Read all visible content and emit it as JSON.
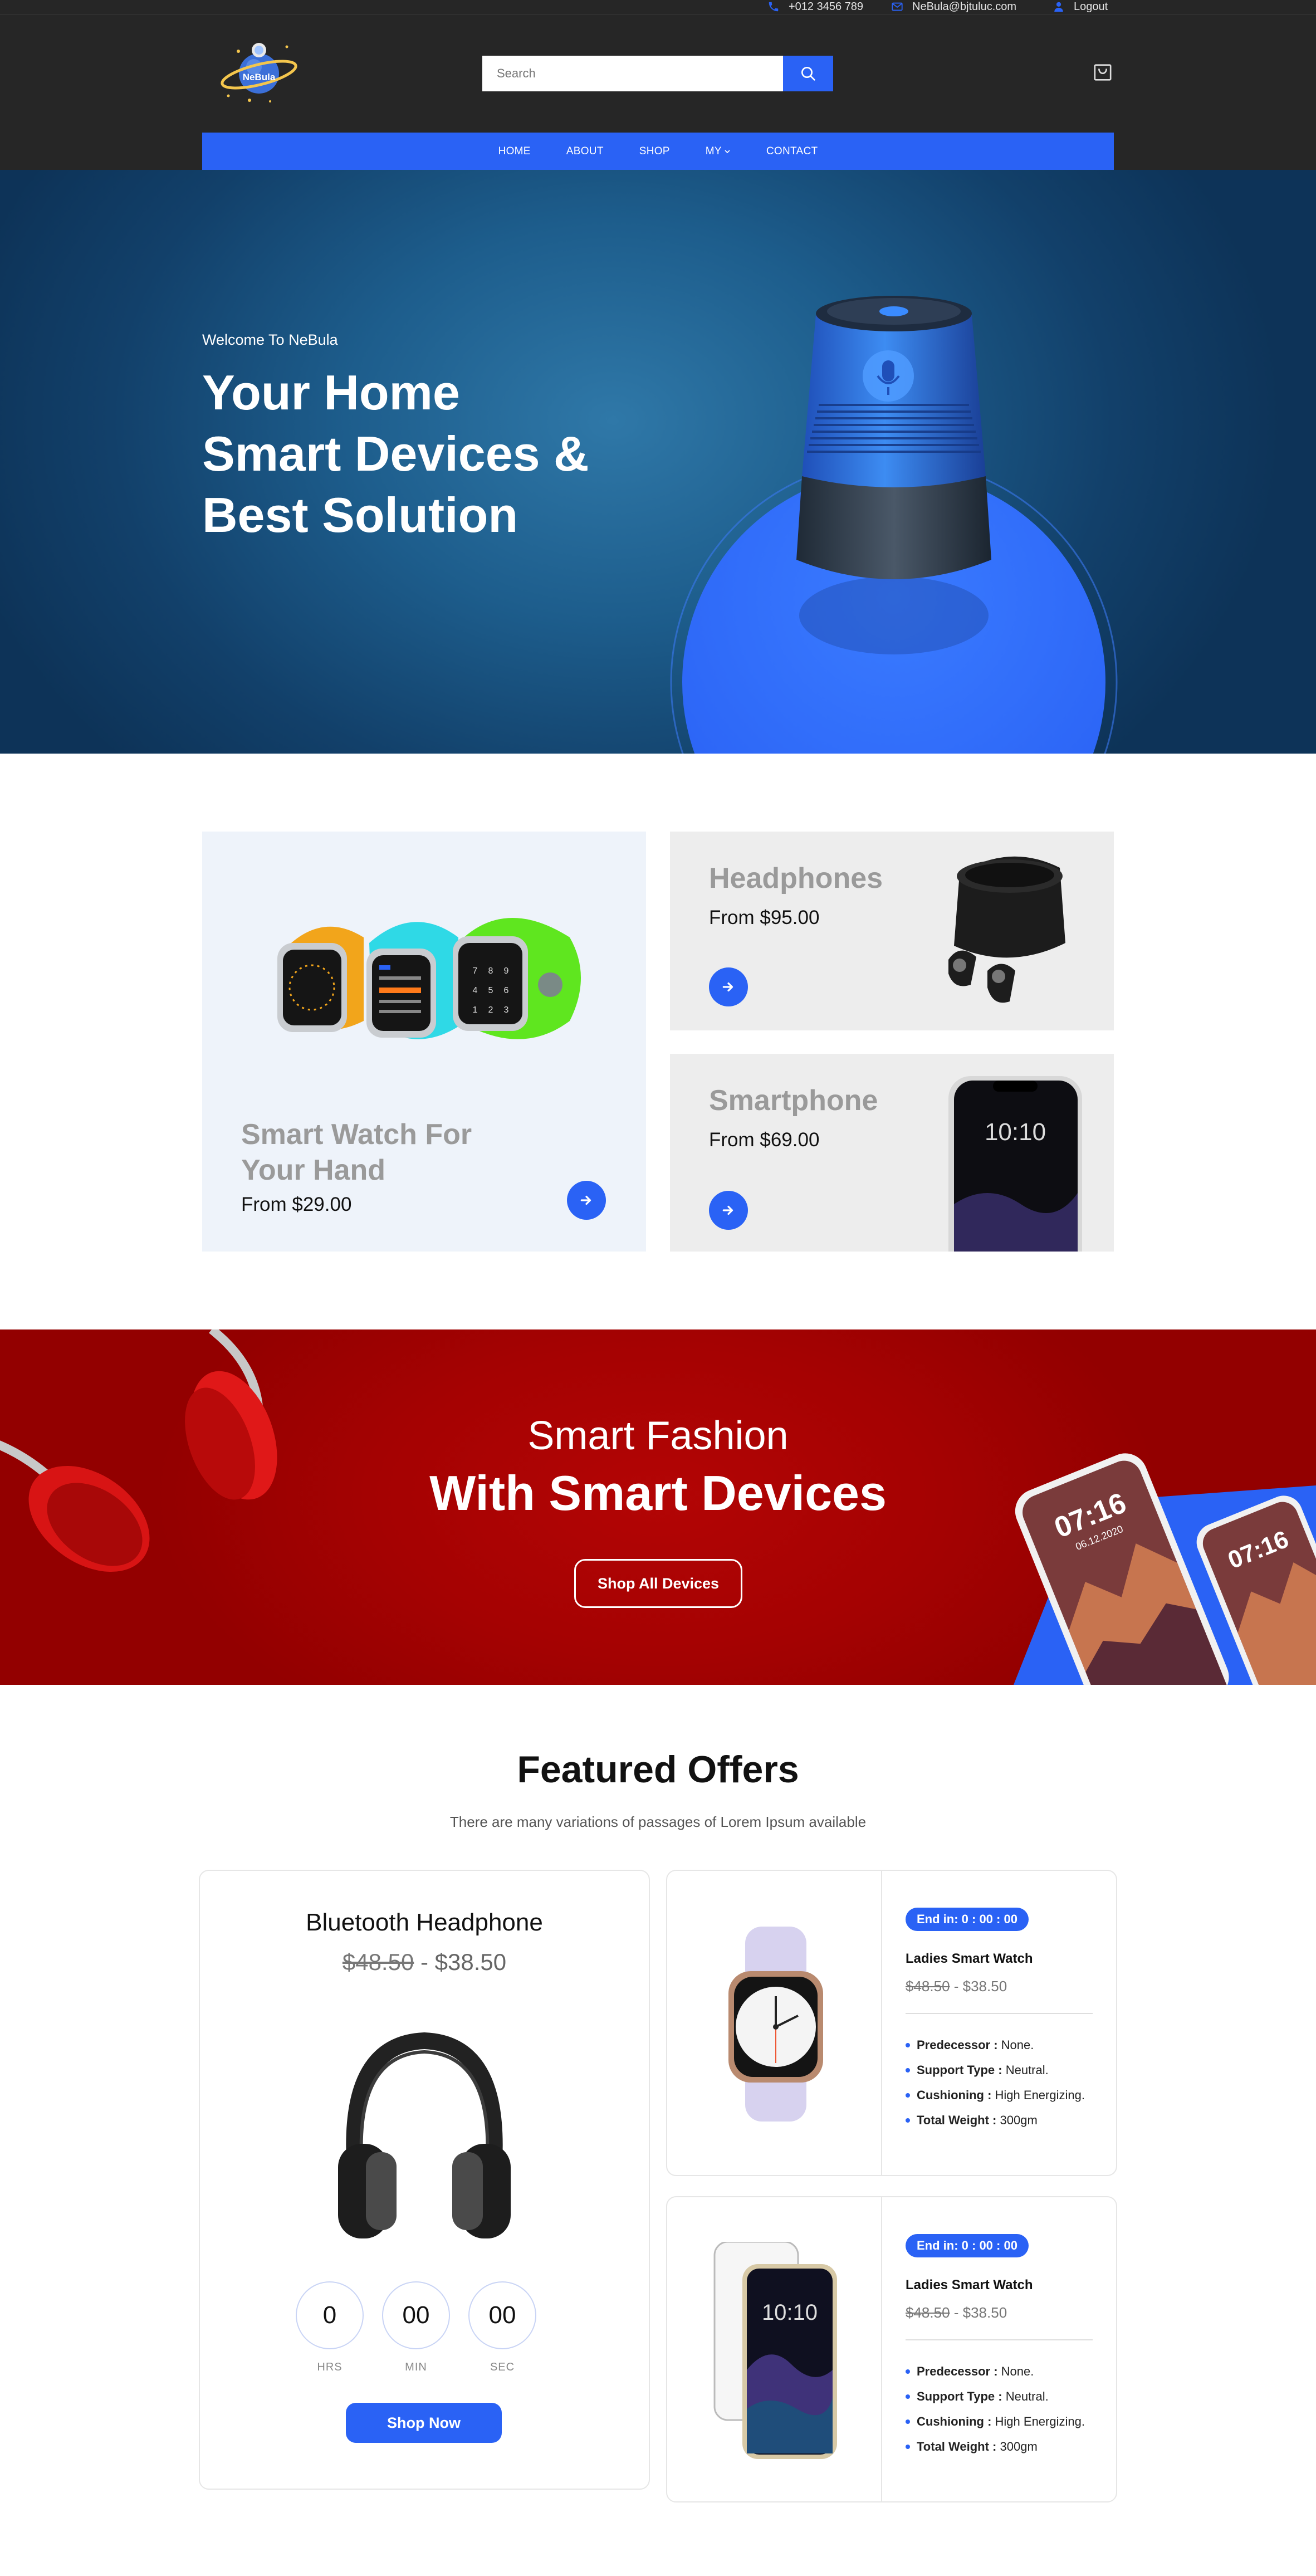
{
  "topbar": {
    "phone": "+012 3456 789",
    "email": "NeBula@bjtuluc.com",
    "logout": "Logout"
  },
  "header": {
    "logo_text": "NeBula",
    "search_placeholder": "Search"
  },
  "nav": {
    "items": [
      "HOME",
      "ABOUT",
      "SHOP",
      "MY",
      "CONTACT"
    ]
  },
  "hero": {
    "welcome": "Welcome To NeBula",
    "title_lines": [
      "Your Home",
      "Smart Devices &",
      "Best Solution"
    ]
  },
  "promo": {
    "watch": {
      "title_lines": [
        "Smart Watch For",
        "Your Hand"
      ],
      "price": "From $29.00"
    },
    "headphones": {
      "title": "Headphones",
      "price": "From $95.00"
    },
    "smartphone": {
      "title": "Smartphone",
      "price": "From $69.00",
      "screen_time": "10:10"
    }
  },
  "banner": {
    "subtitle": "Smart Fashion",
    "title": "With Smart Devices",
    "button": "Shop All Devices",
    "phone_time": "07:16",
    "phone_time2": "07:16",
    "phone_date": "06.12.2020"
  },
  "featured": {
    "title": "Featured Offers",
    "subtitle": "There are many variations of passages of Lorem Ipsum available",
    "big_offer": {
      "name": "Bluetooth Headphone",
      "old_price": "$48.50",
      "separator": " - ",
      "price": "$38.50",
      "countdown": [
        {
          "value": "0",
          "label": "HRS"
        },
        {
          "value": "00",
          "label": "MIN"
        },
        {
          "value": "00",
          "label": "SEC"
        }
      ],
      "button": "Shop Now"
    },
    "small_offers": [
      {
        "badge": "End in:  0 : 00 : 00",
        "name": "Ladies Smart Watch",
        "old_price": "$48.50",
        "separator": " - ",
        "price": "$38.50",
        "specs": [
          {
            "label": "Predecessor :",
            "value": " None."
          },
          {
            "label": "Support Type :",
            "value": " Neutral."
          },
          {
            "label": "Cushioning :",
            "value": " High Energizing."
          },
          {
            "label": "Total Weight :",
            "value": " 300gm"
          }
        ]
      },
      {
        "badge": "End in:  0 : 00 : 00",
        "name": "Ladies Smart Watch",
        "old_price": "$48.50",
        "separator": " - ",
        "price": "$38.50",
        "specs": [
          {
            "label": "Predecessor :",
            "value": " None."
          },
          {
            "label": "Support Type :",
            "value": " Neutral."
          },
          {
            "label": "Cushioning :",
            "value": " High Energizing."
          },
          {
            "label": "Total Weight :",
            "value": " 300gm"
          }
        ]
      }
    ]
  },
  "colors": {
    "accent": "#2a62f5",
    "header_bg": "#262626",
    "banner_red": "#a50202",
    "hero_blue": "#1d5d8c"
  }
}
